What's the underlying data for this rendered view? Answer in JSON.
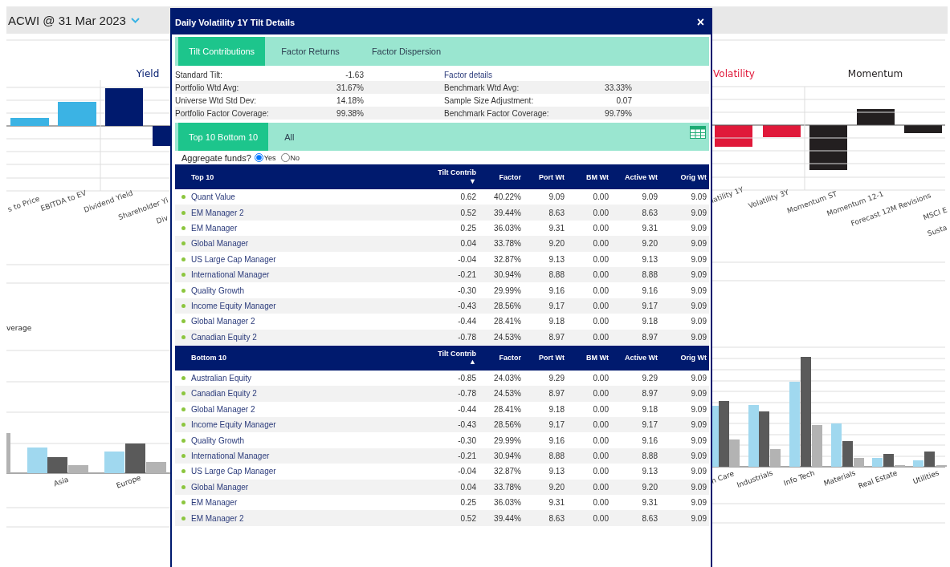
{
  "header": {
    "title": "ACWI @ 31 Mar 2023"
  },
  "factor_chart": {
    "left_groups": [
      {
        "title": "Yield",
        "color": "#001a6e"
      }
    ],
    "right_groups": [
      {
        "title": "Volatility",
        "color": "#e0193a"
      },
      {
        "title": "Momentum",
        "color": "#231f20"
      }
    ],
    "left_labels": [
      "s to Price",
      "EBITDA to EV",
      "Dividend Yield",
      "Shareholder Yi",
      "Div"
    ],
    "right_labels": [
      "latility 1Y",
      "Volatility 3Y",
      "Momentum ST",
      "Momentum 12-1",
      "Forecast 12M Revisions",
      "MSCI E",
      "Susta"
    ]
  },
  "region_chart": {
    "axis_label": "verage",
    "categories": [
      "Asia",
      "Europe"
    ]
  },
  "sector_chart": {
    "categories": [
      "n Care",
      "Industrials",
      "Info Tech",
      "Materials",
      "Real Estate",
      "Utilities"
    ]
  },
  "dialog": {
    "title": "Daily Volatility 1Y Tilt Details",
    "close": "×",
    "tabs": [
      {
        "label": "Tilt Contributions",
        "selected": true
      },
      {
        "label": "Factor Returns",
        "selected": false
      },
      {
        "label": "Factor Dispersion",
        "selected": false
      }
    ],
    "details": [
      {
        "label": "Standard Tilt:",
        "value": "-1.63",
        "label_2": "Factor details"
      },
      {
        "label": "Portfolio Wtd Avg:",
        "value": "31.67%",
        "label_2": "Benchmark Wtd Avg:",
        "value_2": "33.33%"
      },
      {
        "label": "Universe Wtd Std Dev:",
        "value": "14.18%",
        "label_2": "Sample Size Adjustment:",
        "value_2": "0.07"
      },
      {
        "label": "Portfolio Factor Coverage:",
        "value": "99.38%",
        "label_2": "Benchmark Factor Coverage:",
        "value_2": "99.79%"
      }
    ],
    "view_tabs": [
      {
        "label": "Top 10 Bottom 10",
        "selected": true
      },
      {
        "label": "All",
        "selected": false
      }
    ],
    "aggregate": {
      "label": "Aggregate funds?",
      "options": [
        {
          "label": "Yes",
          "selected": true
        },
        {
          "label": "No",
          "selected": false
        }
      ]
    },
    "tables": [
      {
        "title": "Top 10",
        "sort_indicator": "▼",
        "columns": [
          "Tilt Contrib",
          "Factor",
          "Port Wt",
          "BM Wt",
          "Active Wt",
          "Orig Wt"
        ],
        "rows": [
          {
            "name": "Quant Value",
            "values": [
              "0.62",
              "40.22%",
              "9.09",
              "0.00",
              "9.09",
              "9.09"
            ]
          },
          {
            "name": "EM Manager 2",
            "values": [
              "0.52",
              "39.44%",
              "8.63",
              "0.00",
              "8.63",
              "9.09"
            ]
          },
          {
            "name": "EM Manager",
            "values": [
              "0.25",
              "36.03%",
              "9.31",
              "0.00",
              "9.31",
              "9.09"
            ]
          },
          {
            "name": "Global Manager",
            "values": [
              "0.04",
              "33.78%",
              "9.20",
              "0.00",
              "9.20",
              "9.09"
            ]
          },
          {
            "name": "US Large Cap Manager",
            "values": [
              "-0.04",
              "32.87%",
              "9.13",
              "0.00",
              "9.13",
              "9.09"
            ]
          },
          {
            "name": "International Manager",
            "values": [
              "-0.21",
              "30.94%",
              "8.88",
              "0.00",
              "8.88",
              "9.09"
            ]
          },
          {
            "name": "Quality Growth",
            "values": [
              "-0.30",
              "29.99%",
              "9.16",
              "0.00",
              "9.16",
              "9.09"
            ]
          },
          {
            "name": "Income Equity Manager",
            "values": [
              "-0.43",
              "28.56%",
              "9.17",
              "0.00",
              "9.17",
              "9.09"
            ]
          },
          {
            "name": "Global Manager 2",
            "values": [
              "-0.44",
              "28.41%",
              "9.18",
              "0.00",
              "9.18",
              "9.09"
            ]
          },
          {
            "name": "Canadian Equity 2",
            "values": [
              "-0.78",
              "24.53%",
              "8.97",
              "0.00",
              "8.97",
              "9.09"
            ]
          }
        ]
      },
      {
        "title": "Bottom 10",
        "sort_indicator": "▲",
        "columns": [
          "Tilt Contrib",
          "Factor",
          "Port Wt",
          "BM Wt",
          "Active Wt",
          "Orig Wt"
        ],
        "rows": [
          {
            "name": "Australian Equity",
            "values": [
              "-0.85",
              "24.03%",
              "9.29",
              "0.00",
              "9.29",
              "9.09"
            ]
          },
          {
            "name": "Canadian Equity 2",
            "values": [
              "-0.78",
              "24.53%",
              "8.97",
              "0.00",
              "8.97",
              "9.09"
            ]
          },
          {
            "name": "Global Manager 2",
            "values": [
              "-0.44",
              "28.41%",
              "9.18",
              "0.00",
              "9.18",
              "9.09"
            ]
          },
          {
            "name": "Income Equity Manager",
            "values": [
              "-0.43",
              "28.56%",
              "9.17",
              "0.00",
              "9.17",
              "9.09"
            ]
          },
          {
            "name": "Quality Growth",
            "values": [
              "-0.30",
              "29.99%",
              "9.16",
              "0.00",
              "9.16",
              "9.09"
            ]
          },
          {
            "name": "International Manager",
            "values": [
              "-0.21",
              "30.94%",
              "8.88",
              "0.00",
              "8.88",
              "9.09"
            ]
          },
          {
            "name": "US Large Cap Manager",
            "values": [
              "-0.04",
              "32.87%",
              "9.13",
              "0.00",
              "9.13",
              "9.09"
            ]
          },
          {
            "name": "Global Manager",
            "values": [
              "0.04",
              "33.78%",
              "9.20",
              "0.00",
              "9.20",
              "9.09"
            ]
          },
          {
            "name": "EM Manager",
            "values": [
              "0.25",
              "36.03%",
              "9.31",
              "0.00",
              "9.31",
              "9.09"
            ]
          },
          {
            "name": "EM Manager 2",
            "values": [
              "0.52",
              "39.44%",
              "8.63",
              "0.00",
              "8.63",
              "9.09"
            ]
          }
        ]
      }
    ]
  }
}
